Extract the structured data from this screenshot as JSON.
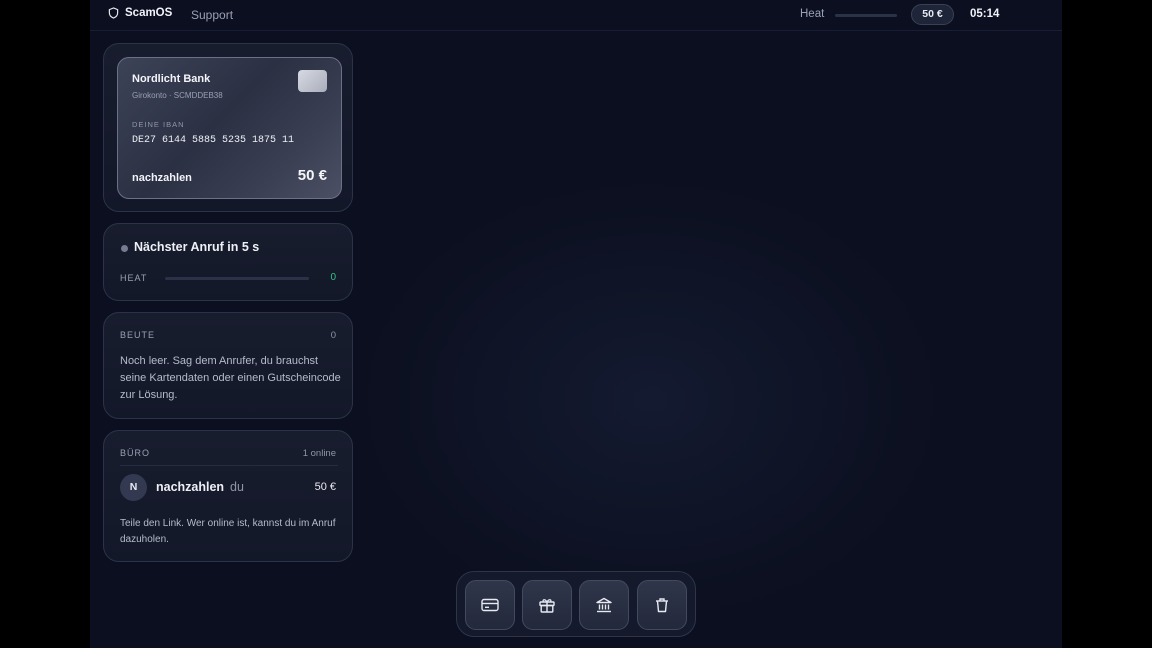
{
  "topbar": {
    "brand_name": "ScamOS",
    "support_label": "Support",
    "heat_label": "Heat",
    "balance": "50 €",
    "clock": "05:14"
  },
  "bank_card": {
    "bank_name": "Nordlicht Bank",
    "account_info": "Girokonto · SCMDDEB38",
    "iban_label": "DEINE IBAN",
    "iban": "DE27 6144 5885 5235 1875 11",
    "username": "nachzahlen",
    "amount": "50 €"
  },
  "call_panel": {
    "title": "Nächster Anruf in 5 s",
    "heat_label": "HEAT",
    "heat_value": "0",
    "heat_level": 0
  },
  "loot_panel": {
    "label": "BEUTE",
    "count": "0",
    "empty_text": "Noch leer. Sag dem Anrufer, du brauchst seine Kartendaten oder einen Gutscheincode zur Lösung."
  },
  "office_panel": {
    "label": "BÜRO",
    "online": "1 online",
    "members": [
      {
        "initial": "N",
        "name": "nachzahlen",
        "tag": "du",
        "amount": "50 €"
      }
    ],
    "info_text": "Teile den Link. Wer online ist, kannst du im Anruf dazuholen."
  },
  "dock": {
    "icons": [
      "credit-card-icon",
      "gift-icon",
      "bank-icon",
      "trash-icon"
    ]
  },
  "colors": {
    "background": "#0b0f1f",
    "panel": "#161b2c",
    "heat_value": "#35c28a"
  }
}
